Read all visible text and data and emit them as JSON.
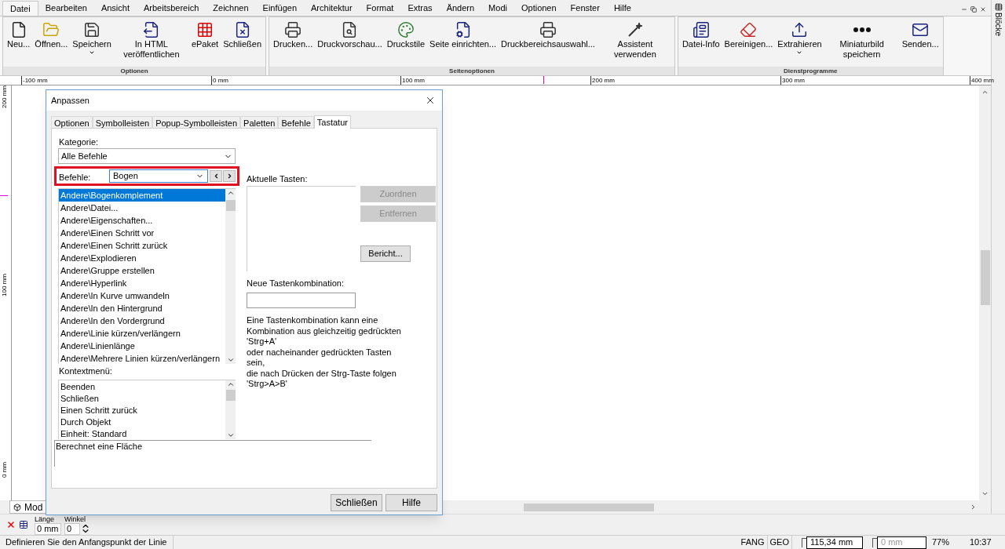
{
  "menu_bar": [
    {
      "label": "Datei",
      "selected": true
    },
    {
      "label": "Bearbeiten",
      "selected": false
    },
    {
      "label": "Ansicht",
      "selected": false
    },
    {
      "label": "Arbeitsbereich",
      "selected": false
    },
    {
      "label": "Zeichnen",
      "selected": false
    },
    {
      "label": "Einfügen",
      "selected": false
    },
    {
      "label": "Architektur",
      "selected": false
    },
    {
      "label": "Format",
      "selected": false
    },
    {
      "label": "Extras",
      "selected": false
    },
    {
      "label": "Ändern",
      "selected": false
    },
    {
      "label": "Modi",
      "selected": false
    },
    {
      "label": "Optionen",
      "selected": false
    },
    {
      "label": "Fenster",
      "selected": false
    },
    {
      "label": "Hilfe",
      "selected": false
    }
  ],
  "ribbon": [
    {
      "title": "Optionen",
      "items": [
        {
          "label": "Neu...",
          "dropdown": false
        },
        {
          "label": "Öffnen...",
          "dropdown": false
        },
        {
          "label": "Speichern",
          "dropdown": true
        },
        {
          "label": "In HTML veröffentlichen",
          "dropdown": false
        },
        {
          "label": "ePaket",
          "dropdown": false
        },
        {
          "label": "Schließen",
          "dropdown": false
        }
      ]
    },
    {
      "title": "Seitenoptionen",
      "items": [
        {
          "label": "Drucken...",
          "dropdown": false
        },
        {
          "label": "Druckvorschau...",
          "dropdown": false
        },
        {
          "label": "Druckstile",
          "dropdown": false
        },
        {
          "label": "Seite einrichten...",
          "dropdown": false
        },
        {
          "label": "Druckbereichsauswahl...",
          "dropdown": false
        },
        {
          "label": "Assistent verwenden",
          "dropdown": false
        }
      ]
    },
    {
      "title": "Dienstprogramme",
      "items": [
        {
          "label": "Datei-Info",
          "dropdown": false
        },
        {
          "label": "Bereinigen...",
          "dropdown": false
        },
        {
          "label": "Extrahieren",
          "dropdown": true
        },
        {
          "label": "Miniaturbild speichern",
          "dropdown": false
        },
        {
          "label": "Senden...",
          "dropdown": false
        }
      ]
    }
  ],
  "side_panel": {
    "tab": "Blöcke"
  },
  "ruler_top": [
    "-100 mm",
    "0 mm",
    "100 mm",
    "200 mm",
    "300 mm",
    "400 mm"
  ],
  "ruler_left": [
    "200 mm",
    "100 mm",
    "0 mm"
  ],
  "model_tab": "Mod",
  "dialog": {
    "title": "Anpassen",
    "tabs": [
      {
        "label": "Optionen",
        "selected": false
      },
      {
        "label": "Symbolleisten",
        "selected": false
      },
      {
        "label": "Popup-Symbolleisten",
        "selected": false
      },
      {
        "label": "Paletten",
        "selected": false
      },
      {
        "label": "Befehle",
        "selected": false
      },
      {
        "label": "Tastatur",
        "selected": true
      }
    ],
    "category_label": "Kategorie:",
    "category_value": "Alle Befehle",
    "commands_label": "Befehle:",
    "commands_value": "Bogen",
    "commands": [
      {
        "label": "Andere\\Bogenkomplement",
        "selected": true
      },
      {
        "label": "Andere\\Datei...",
        "selected": false
      },
      {
        "label": "Andere\\Eigenschaften...",
        "selected": false
      },
      {
        "label": "Andere\\Einen Schritt vor",
        "selected": false
      },
      {
        "label": "Andere\\Einen Schritt zurück",
        "selected": false
      },
      {
        "label": "Andere\\Explodieren",
        "selected": false
      },
      {
        "label": "Andere\\Gruppe erstellen",
        "selected": false
      },
      {
        "label": "Andere\\Hyperlink",
        "selected": false
      },
      {
        "label": "Andere\\In Kurve umwandeln",
        "selected": false
      },
      {
        "label": "Andere\\In den Hintergrund",
        "selected": false
      },
      {
        "label": "Andere\\In den Vordergrund",
        "selected": false
      },
      {
        "label": "Andere\\Linie kürzen/verlängern",
        "selected": false
      },
      {
        "label": "Andere\\Linienlänge",
        "selected": false
      },
      {
        "label": "Andere\\Mehrere Linien kürzen/verlängern",
        "selected": false
      }
    ],
    "context_label": "Kontextmenü:",
    "context_items": [
      "Beenden",
      "Schließen",
      "Einen Schritt zurück",
      "Durch Objekt",
      "Einheit: Standard"
    ],
    "current_keys_label": "Aktuelle Tasten:",
    "side_buttons": [
      {
        "label": "Zuordnen",
        "disabled": true
      },
      {
        "label": "Entfernen",
        "disabled": true
      },
      {
        "label": "Bericht...",
        "disabled": false
      }
    ],
    "new_combo_label": "Neue Tastenkombination:",
    "help_text": "Eine Tastenkombination kann eine\nKombination aus gleichzeitig gedrückten\n'Strg+A'\noder nacheinander gedrückten Tasten sein,\ndie nach Drücken der Strg-Taste folgen\n'Strg>A>B'",
    "description": "Berechnet eine Fläche",
    "buttons": [
      "Schließen",
      "Hilfe"
    ]
  },
  "input_bar": {
    "length_label": "Länge",
    "length_value": "0 mm",
    "angle_label": "Winkel",
    "angle_value": "0"
  },
  "status_bar": {
    "message": "Definieren Sie den Anfangspunkt der Linie",
    "indicators": [
      "FANG",
      "GEO"
    ],
    "x_value": "115,34 mm",
    "z_placeholder": "0 mm",
    "zoom": "77%",
    "time": "10:37"
  }
}
